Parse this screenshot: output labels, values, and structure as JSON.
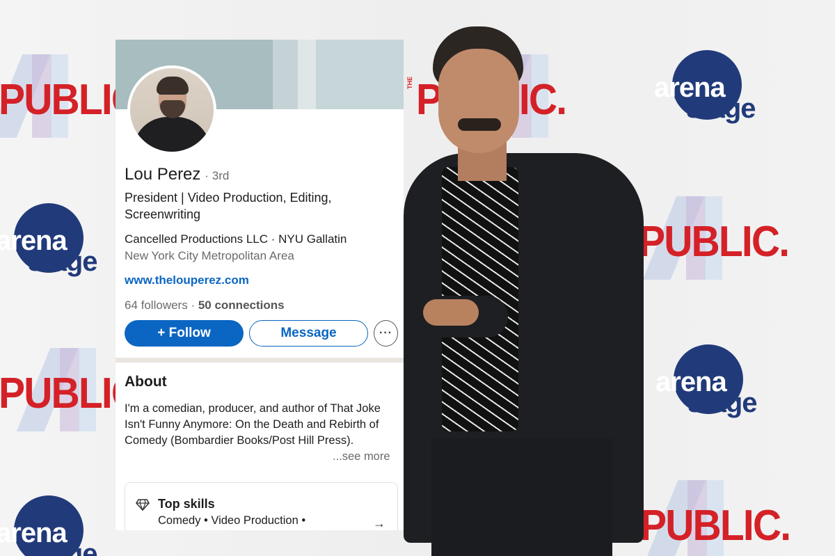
{
  "backdrop": {
    "public_logo_text": "PUBLIC.",
    "public_logo_small": "THE",
    "arena_logo_line1": "arena",
    "arena_logo_line2": "stage",
    "colors": {
      "public_red": "#d42127",
      "arena_navy": "#213a7a"
    }
  },
  "profile": {
    "name": "Lou Perez",
    "degree": "· 3rd",
    "headline": "President | Video Production, Editing, Screenwriting",
    "company_line": "Cancelled Productions LLC · NYU Gallatin",
    "location": "New York City Metropolitan Area",
    "website": "www.thelouperez.com",
    "followers": "64 followers",
    "connections": "50 connections",
    "stats_separator": " · "
  },
  "actions": {
    "follow_label": "+ Follow",
    "message_label": "Message",
    "more_label": "···"
  },
  "about": {
    "title": "About",
    "text": "I'm a comedian, producer, and author of That Joke Isn't Funny Anymore: On the Death and Rebirth of Comedy (Bombardier Books/Post Hill Press).",
    "see_more": "...see more"
  },
  "skills": {
    "icon": "gem-icon",
    "title": "Top skills",
    "list": "Comedy • Video Production •",
    "arrow": "→"
  },
  "colors": {
    "linkedin_blue": "#0a66c2",
    "text_primary": "#1d1d1d",
    "text_secondary": "#6b6b6b",
    "banner": "#a7bdbf"
  }
}
